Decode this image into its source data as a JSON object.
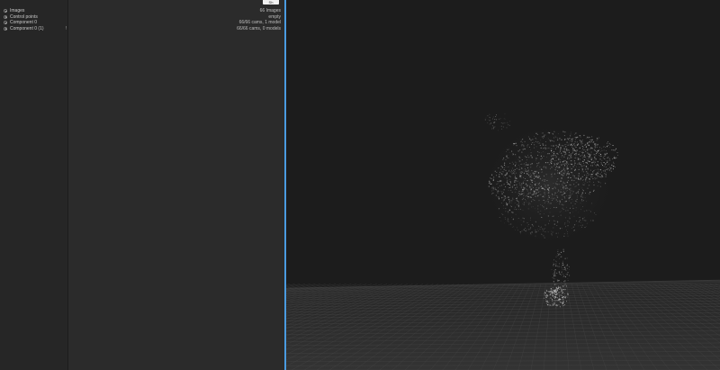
{
  "header": {
    "badge": "Sh"
  },
  "tree": {
    "items": [
      {
        "label": "Images",
        "mark": "",
        "detail": "66 Images"
      },
      {
        "label": "Control points",
        "mark": "",
        "detail": "empty"
      },
      {
        "label": "Component 0",
        "mark": "",
        "detail": "66/66 cams, 1 model"
      },
      {
        "label": "Component 0 (1)",
        "mark": "!",
        "detail": "66/66 cams, 0 models"
      }
    ]
  },
  "viewport": {
    "background": "#1c1c1c",
    "grid_color": "#4a4a4a",
    "point_color": "#d9d9d9"
  }
}
